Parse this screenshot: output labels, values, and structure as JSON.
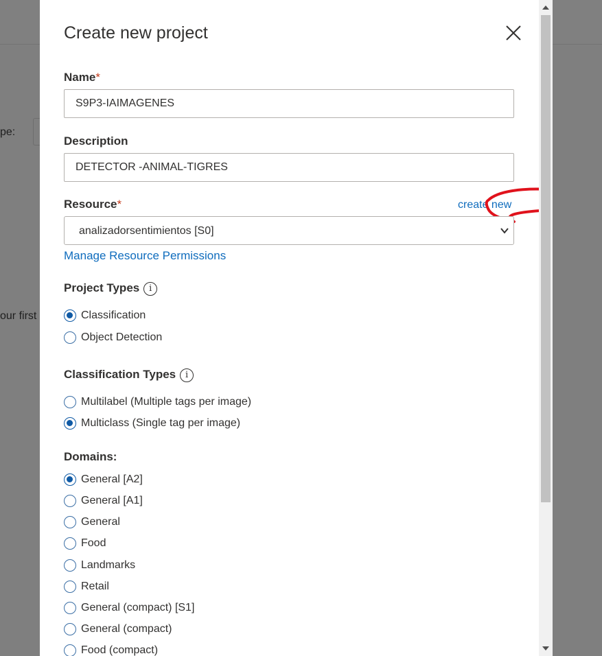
{
  "background": {
    "fragment_1": "pe:",
    "fragment_2": "our first"
  },
  "modal": {
    "title": "Create new project",
    "name": {
      "label": "Name",
      "required_mark": "*",
      "value": "S9P3-IAIMAGENES"
    },
    "description": {
      "label": "Description",
      "value": "DETECTOR -ANIMAL-TIGRES"
    },
    "resource": {
      "label": "Resource",
      "required_mark": "*",
      "create_new": "create new",
      "selected": "analizadorsentimientos [S0]",
      "manage_link": "Manage Resource Permissions"
    },
    "project_types": {
      "label": "Project Types",
      "info_glyph": "i",
      "options": [
        {
          "label": "Classification",
          "selected": true
        },
        {
          "label": "Object Detection",
          "selected": false
        }
      ]
    },
    "classification_types": {
      "label": "Classification Types",
      "info_glyph": "i",
      "options": [
        {
          "label": "Multilabel (Multiple tags per image)",
          "selected": false
        },
        {
          "label": "Multiclass (Single tag per image)",
          "selected": true
        }
      ]
    },
    "domains": {
      "label": "Domains:",
      "options": [
        {
          "label": "General [A2]",
          "selected": true
        },
        {
          "label": "General [A1]",
          "selected": false
        },
        {
          "label": "General",
          "selected": false
        },
        {
          "label": "Food",
          "selected": false
        },
        {
          "label": "Landmarks",
          "selected": false
        },
        {
          "label": "Retail",
          "selected": false
        },
        {
          "label": "General (compact) [S1]",
          "selected": false
        },
        {
          "label": "General (compact)",
          "selected": false
        },
        {
          "label": "Food (compact)",
          "selected": false
        }
      ]
    }
  },
  "colors": {
    "accent": "#0f6cbd",
    "required": "#c43b1c",
    "annotation": "#e0121c",
    "overlay": "#7f7f7f"
  }
}
